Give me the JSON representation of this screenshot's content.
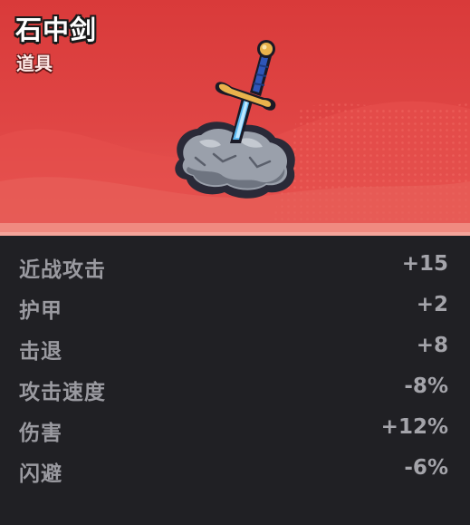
{
  "item": {
    "name": "石中剑",
    "type": "道具",
    "icon": "sword-in-stone-icon"
  },
  "colors": {
    "header_red": "#e04645",
    "panel_bg": "#202024",
    "stat_text": "#9a9aa0"
  },
  "stats": [
    {
      "label": "近战攻击",
      "value": "+15"
    },
    {
      "label": "护甲",
      "value": "+2"
    },
    {
      "label": "击退",
      "value": "+8"
    },
    {
      "label": "攻击速度",
      "value": "-8%"
    },
    {
      "label": "伤害",
      "value": "+12%"
    },
    {
      "label": "闪避",
      "value": "-6%"
    }
  ]
}
